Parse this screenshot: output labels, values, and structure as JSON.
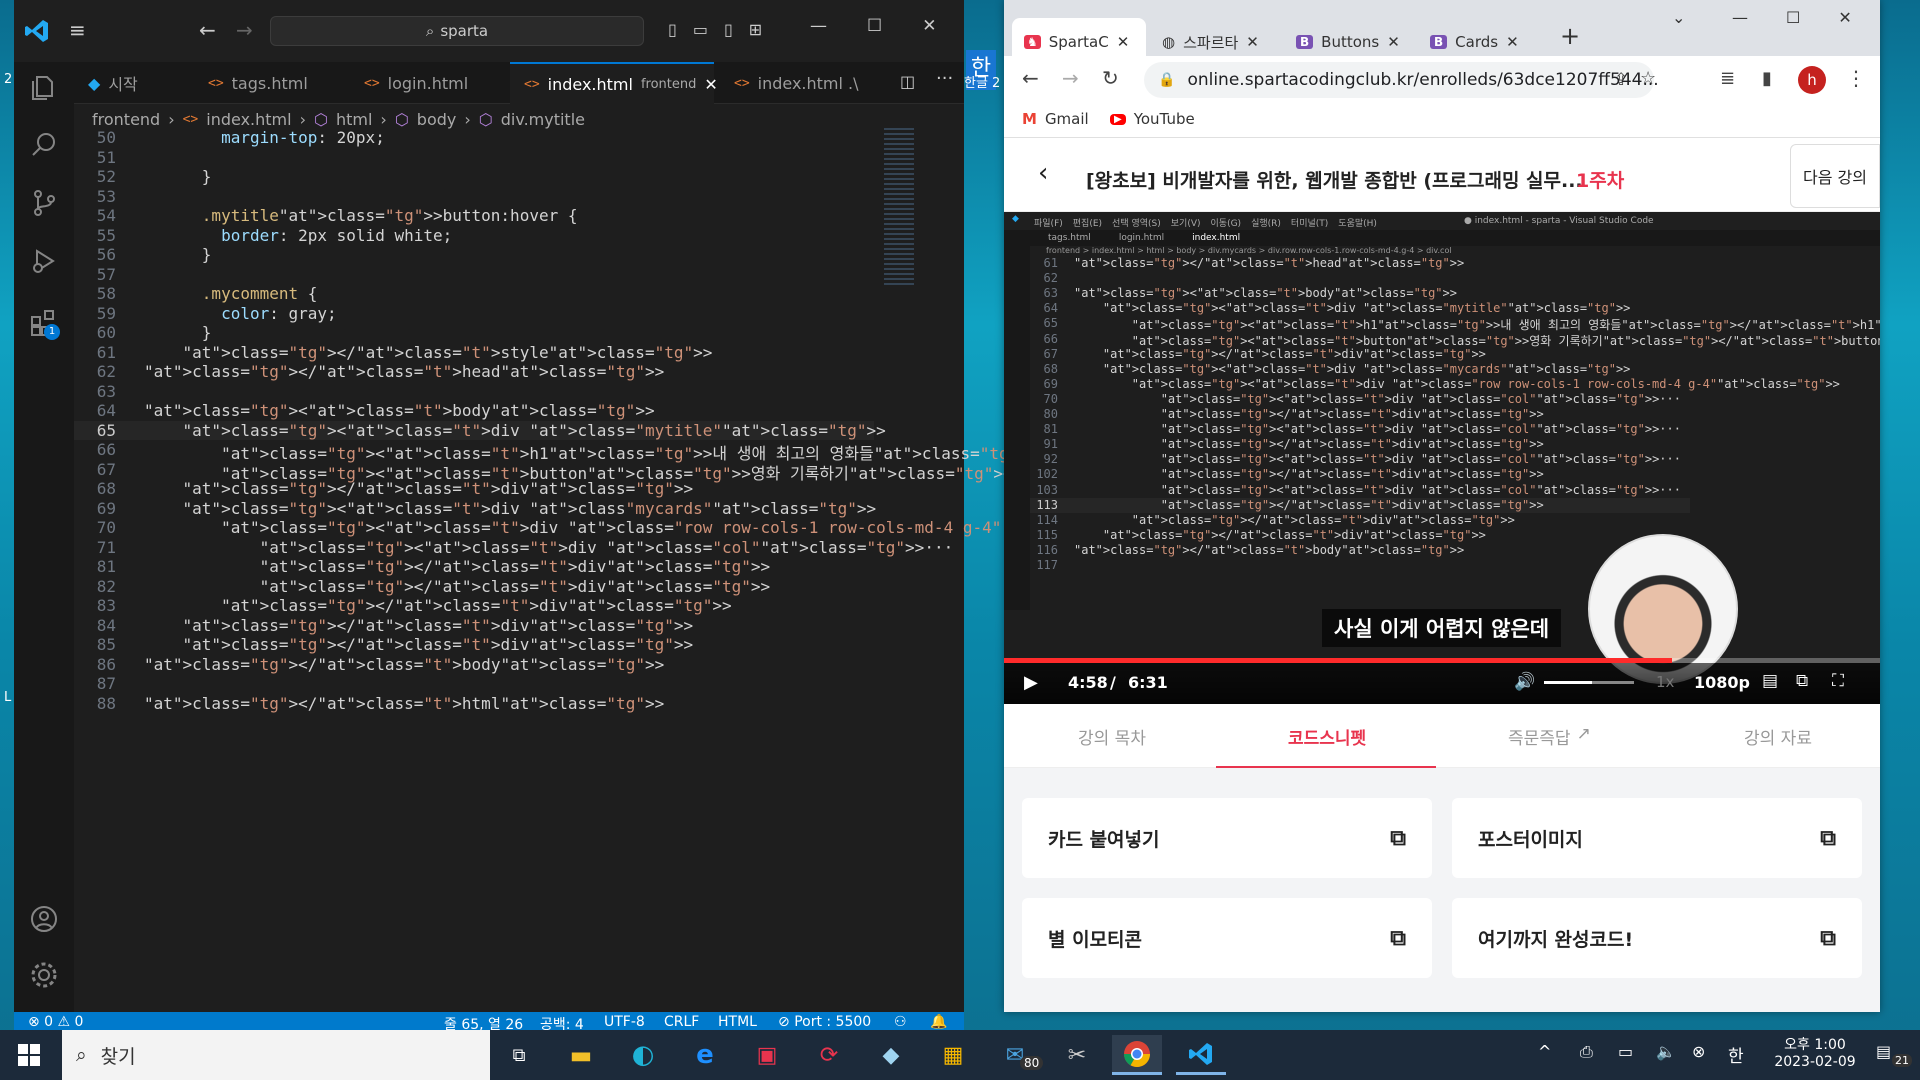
{
  "vscode": {
    "search": "sparta",
    "tabs": [
      "시작",
      "tags.html",
      "login.html",
      "index.html",
      "frontend",
      "index.html .\\"
    ],
    "breadcrumb": [
      "frontend",
      "index.html",
      "html",
      "body",
      "div.mytitle"
    ],
    "lines": [
      {
        "n": "50",
        "code": "        margin-top: 20px;"
      },
      {
        "n": "51",
        "code": ""
      },
      {
        "n": "52",
        "code": "      }"
      },
      {
        "n": "53",
        "code": ""
      },
      {
        "n": "54",
        "code": "      .mytitle>button:hover {"
      },
      {
        "n": "55",
        "code": "        border: 2px solid white;"
      },
      {
        "n": "56",
        "code": "      }"
      },
      {
        "n": "57",
        "code": ""
      },
      {
        "n": "58",
        "code": "      .mycomment {"
      },
      {
        "n": "59",
        "code": "        color: gray;"
      },
      {
        "n": "60",
        "code": "      }"
      },
      {
        "n": "61",
        "code": "    </style>"
      },
      {
        "n": "62",
        "code": "</head>"
      },
      {
        "n": "63",
        "code": ""
      },
      {
        "n": "64",
        "code": "<body>"
      },
      {
        "n": "65",
        "code": "    <div class=\"mytitle\">"
      },
      {
        "n": "66",
        "code": "        <h1>내 생애 최고의 영화들</h1>"
      },
      {
        "n": "67",
        "code": "        <button>영화 기록하기</button>"
      },
      {
        "n": "68",
        "code": "    </div>"
      },
      {
        "n": "69",
        "code": "    <div class\"mycards\">"
      },
      {
        "n": "70",
        "code": "        <div class=\"row row-cols-1 row-cols-md-4 g-4\">"
      },
      {
        "n": "71",
        "code": "            <div class=\"col\">···"
      },
      {
        "n": "81",
        "code": "            </div>"
      },
      {
        "n": "82",
        "code": "            </div>"
      },
      {
        "n": "83",
        "code": "        </div>"
      },
      {
        "n": "84",
        "code": "    </div>"
      },
      {
        "n": "85",
        "code": "    </div>"
      },
      {
        "n": "86",
        "code": "</body>"
      },
      {
        "n": "87",
        "code": ""
      },
      {
        "n": "88",
        "code": "</html>"
      }
    ],
    "status": {
      "errors": "⊗ 0 ⚠ 0",
      "position": "줄 65, 열 26",
      "spaces": "공백: 4",
      "encoding": "UTF-8",
      "eol": "CRLF",
      "lang": "HTML",
      "port": "Port : 5500"
    },
    "extensions_badge": "1"
  },
  "chrome": {
    "tabs": [
      "SpartaC",
      "스파르타",
      "Buttons",
      "Cards"
    ],
    "url": "online.spartacodingclub.kr/enrolleds/63dce1207ff544...",
    "profile": "h",
    "bookmarks": [
      "Gmail",
      "YouTube"
    ],
    "course_title": "[왕초보] 비개발자를 위한, 웹개발 종합반 (프로그래밍 실무...",
    "week": "1주차",
    "next_lecture": "다음 강의",
    "video": {
      "caption": "사실 이게 어렵지 않은데",
      "current_time": "4:58",
      "separator": "/",
      "duration": "6:31",
      "progress": 0.763,
      "speed": "1x",
      "quality": "1080p",
      "inner_breadcrumb": "frontend > index.html > html > body > div.mycards > div.row.row-cols-1.row-cols-md-4.g-4 > div.col",
      "inner_tabs": [
        "tags.html",
        "login.html",
        "index.html"
      ],
      "inner_title": "● index.html - sparta - Visual Studio Code",
      "inner_menu": [
        "파일(F)",
        "편집(E)",
        "선택 영역(S)",
        "보기(V)",
        "이동(G)",
        "실행(R)",
        "터미널(T)",
        "도움말(H)"
      ],
      "inner_lines": [
        {
          "n": "61",
          "code": "</head>"
        },
        {
          "n": "62",
          "code": ""
        },
        {
          "n": "63",
          "code": "<body>"
        },
        {
          "n": "64",
          "code": "    <div class=\"mytitle\">"
        },
        {
          "n": "65",
          "code": "        <h1>내 생애 최고의 영화들</h1>"
        },
        {
          "n": "66",
          "code": "        <button>영화 기록하기</button>"
        },
        {
          "n": "67",
          "code": "    </div>"
        },
        {
          "n": "68",
          "code": "    <div class=\"mycards\">"
        },
        {
          "n": "69",
          "code": "        <div class=\"row row-cols-1 row-cols-md-4 g-4\">"
        },
        {
          "n": "70",
          "code": "            <div class=\"col\">···"
        },
        {
          "n": "80",
          "code": "            </div>"
        },
        {
          "n": "81",
          "code": "            <div class=\"col\">···"
        },
        {
          "n": "91",
          "code": "            </div>"
        },
        {
          "n": "92",
          "code": "            <div class=\"col\">···"
        },
        {
          "n": "102",
          "code": "            </div>"
        },
        {
          "n": "103",
          "code": "            <div class=\"col\">···"
        },
        {
          "n": "113",
          "code": "            </div>"
        },
        {
          "n": "114",
          "code": "        </div>"
        },
        {
          "n": "115",
          "code": "    </div>"
        },
        {
          "n": "116",
          "code": "</body>"
        },
        {
          "n": "117",
          "code": ""
        }
      ]
    },
    "page_tabs": [
      "강의 목차",
      "코드스니펫",
      "즉문즉답",
      "강의 자료"
    ],
    "snippets": [
      "카드 붙여넣기",
      "포스터이미지",
      "별 이모티콘",
      "여기까지 완성코드!"
    ]
  },
  "desktop": {
    "left_label": "한글 2",
    "left_glyph": "L"
  },
  "taskbar": {
    "search": "찾기",
    "mail_badge": "80",
    "ime": "한",
    "ampm_time": "오후 1:00",
    "date": "2023-02-09",
    "notif_count": "21"
  },
  "colors": {
    "vscode_bg": "#1e1e1e",
    "accent_blue": "#007acc",
    "sparta_red": "#e8344e"
  }
}
